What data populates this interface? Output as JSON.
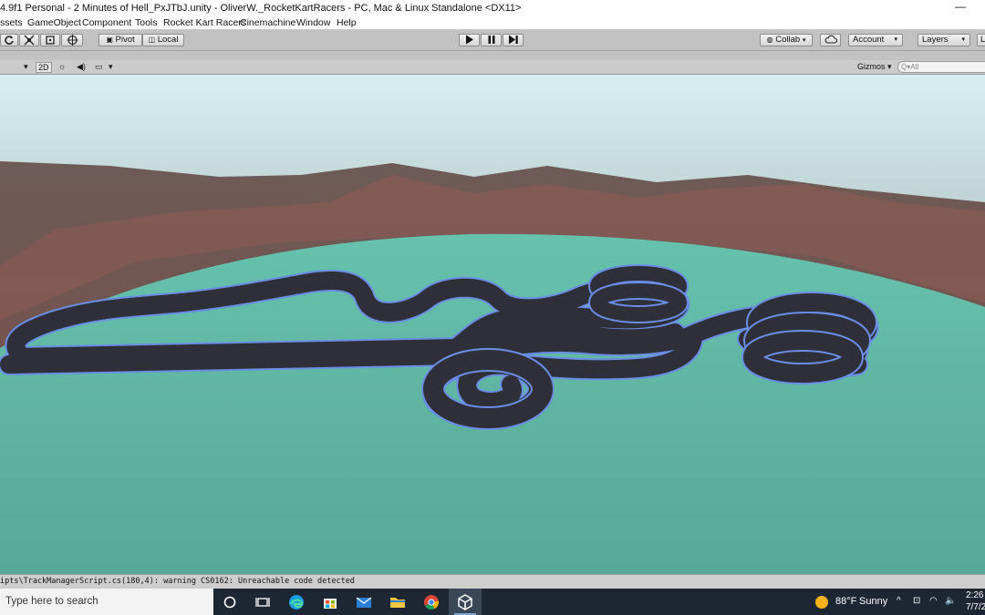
{
  "window": {
    "title": "4.9f1 Personal - 2 Minutes of Hell_PxJTbJ.unity - OliverW._RocketKartRacers - PC, Mac & Linux Standalone <DX11>",
    "minimize": "—"
  },
  "menu": [
    "ssets",
    "GameObject",
    "Component",
    "Tools",
    "Rocket Kart Racers",
    "Cinemachine",
    "Window",
    "Help"
  ],
  "toolbar": {
    "pivot": "Pivot",
    "local": "Local",
    "collab": "Collab",
    "account": "Account",
    "layers": "Layers",
    "layout_partial": "L"
  },
  "scene_toolbar": {
    "mode_2d": "2D",
    "gizmos": "Gizmos",
    "search_placeholder": "Q▾All"
  },
  "status": {
    "message": "ipts\\TrackManagerScript.cs(180,4): warning CS0162: Unreachable code detected"
  },
  "taskbar": {
    "search_placeholder": "Type here to search",
    "weather_temp": "88°F",
    "weather_text": "Sunny",
    "time": "2:26",
    "date": "7/7/2"
  },
  "colors": {
    "ground": "#5fb3a0",
    "sky": "#d7eef0",
    "track": "#2f2f3a",
    "track_outline": "#6a8ee6"
  }
}
